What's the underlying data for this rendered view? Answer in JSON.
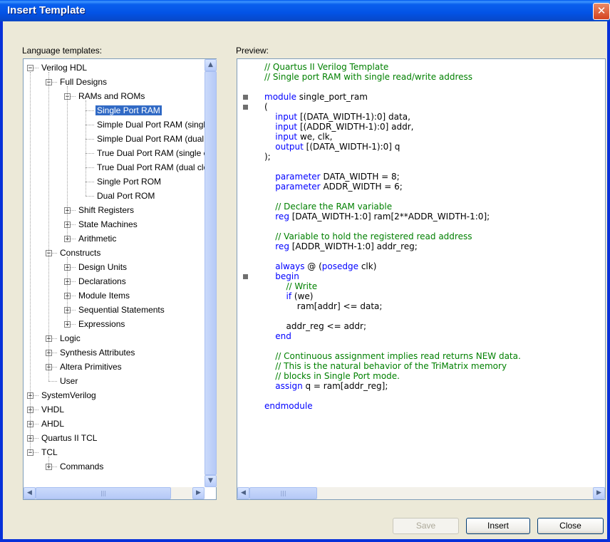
{
  "window": {
    "title": "Insert Template",
    "close_glyph": "✕"
  },
  "labels": {
    "templates": "Language templates:",
    "preview": "Preview:"
  },
  "tree": [
    {
      "label": "Verilog HDL",
      "depth": 0,
      "expander": "minus"
    },
    {
      "label": "Full Designs",
      "depth": 1,
      "expander": "minus"
    },
    {
      "label": "RAMs and ROMs",
      "depth": 2,
      "expander": "minus"
    },
    {
      "label": "Single Port RAM",
      "depth": 3,
      "expander": "none",
      "selected": true
    },
    {
      "label": "Simple Dual Port RAM (single clock)",
      "depth": 3,
      "expander": "none"
    },
    {
      "label": "Simple Dual Port RAM (dual clock)",
      "depth": 3,
      "expander": "none"
    },
    {
      "label": "True Dual Port RAM (single clock)",
      "depth": 3,
      "expander": "none"
    },
    {
      "label": "True Dual Port RAM (dual clock)",
      "depth": 3,
      "expander": "none"
    },
    {
      "label": "Single Port ROM",
      "depth": 3,
      "expander": "none"
    },
    {
      "label": "Dual Port ROM",
      "depth": 3,
      "expander": "none"
    },
    {
      "label": "Shift Registers",
      "depth": 2,
      "expander": "plus"
    },
    {
      "label": "State Machines",
      "depth": 2,
      "expander": "plus"
    },
    {
      "label": "Arithmetic",
      "depth": 2,
      "expander": "plus"
    },
    {
      "label": "Constructs",
      "depth": 1,
      "expander": "minus"
    },
    {
      "label": "Design Units",
      "depth": 2,
      "expander": "plus"
    },
    {
      "label": "Declarations",
      "depth": 2,
      "expander": "plus"
    },
    {
      "label": "Module Items",
      "depth": 2,
      "expander": "plus"
    },
    {
      "label": "Sequential Statements",
      "depth": 2,
      "expander": "plus"
    },
    {
      "label": "Expressions",
      "depth": 2,
      "expander": "plus"
    },
    {
      "label": "Logic",
      "depth": 1,
      "expander": "plus"
    },
    {
      "label": "Synthesis Attributes",
      "depth": 1,
      "expander": "plus"
    },
    {
      "label": "Altera Primitives",
      "depth": 1,
      "expander": "plus"
    },
    {
      "label": "User",
      "depth": 1,
      "expander": "none"
    },
    {
      "label": "SystemVerilog",
      "depth": 0,
      "expander": "plus"
    },
    {
      "label": "VHDL",
      "depth": 0,
      "expander": "plus"
    },
    {
      "label": "AHDL",
      "depth": 0,
      "expander": "plus"
    },
    {
      "label": "Quartus II TCL",
      "depth": 0,
      "expander": "plus"
    },
    {
      "label": "TCL",
      "depth": 0,
      "expander": "minus"
    },
    {
      "label": "Commands",
      "depth": 1,
      "expander": "plus"
    }
  ],
  "code_lines": [
    {
      "y": 0,
      "fold": false,
      "parts": [
        [
          "cm",
          "// Quartus II Verilog Template"
        ]
      ]
    },
    {
      "y": 1,
      "fold": false,
      "parts": [
        [
          "cm",
          "// Single port RAM with single read/write address"
        ]
      ]
    },
    {
      "y": 3,
      "fold": true,
      "parts": [
        [
          "kw",
          "module"
        ],
        [
          "",
          " single_port_ram"
        ]
      ]
    },
    {
      "y": 4,
      "fold": true,
      "parts": [
        [
          "",
          "("
        ]
      ]
    },
    {
      "y": 5,
      "fold": false,
      "parts": [
        [
          "",
          "\t"
        ],
        [
          "kw",
          "input"
        ],
        [
          "",
          " [(DATA_WIDTH-1):0] data,"
        ]
      ]
    },
    {
      "y": 6,
      "fold": false,
      "parts": [
        [
          "",
          "\t"
        ],
        [
          "kw",
          "input"
        ],
        [
          "",
          " [(ADDR_WIDTH-1):0] addr,"
        ]
      ]
    },
    {
      "y": 7,
      "fold": false,
      "parts": [
        [
          "",
          "\t"
        ],
        [
          "kw",
          "input"
        ],
        [
          "",
          " we, clk,"
        ]
      ]
    },
    {
      "y": 8,
      "fold": false,
      "parts": [
        [
          "",
          "\t"
        ],
        [
          "kw",
          "output"
        ],
        [
          "",
          " [(DATA_WIDTH-1):0] q"
        ]
      ]
    },
    {
      "y": 9,
      "fold": false,
      "parts": [
        [
          "",
          ");"
        ]
      ]
    },
    {
      "y": 11,
      "fold": false,
      "parts": [
        [
          "",
          "\t"
        ],
        [
          "kw",
          "parameter"
        ],
        [
          "",
          " DATA_WIDTH = 8;"
        ]
      ]
    },
    {
      "y": 12,
      "fold": false,
      "parts": [
        [
          "",
          "\t"
        ],
        [
          "kw",
          "parameter"
        ],
        [
          "",
          " ADDR_WIDTH = 6;"
        ]
      ]
    },
    {
      "y": 14,
      "fold": false,
      "parts": [
        [
          "",
          "\t"
        ],
        [
          "cm",
          "// Declare the RAM variable"
        ]
      ]
    },
    {
      "y": 15,
      "fold": false,
      "parts": [
        [
          "",
          "\t"
        ],
        [
          "kw",
          "reg"
        ],
        [
          "",
          " [DATA_WIDTH-1:0] ram[2**ADDR_WIDTH-1:0];"
        ]
      ]
    },
    {
      "y": 17,
      "fold": false,
      "parts": [
        [
          "",
          "\t"
        ],
        [
          "cm",
          "// Variable to hold the registered read address"
        ]
      ]
    },
    {
      "y": 18,
      "fold": false,
      "parts": [
        [
          "",
          "\t"
        ],
        [
          "kw",
          "reg"
        ],
        [
          "",
          " [ADDR_WIDTH-1:0] addr_reg;"
        ]
      ]
    },
    {
      "y": 20,
      "fold": false,
      "parts": [
        [
          "",
          "\t"
        ],
        [
          "kw",
          "always"
        ],
        [
          "",
          " @ ("
        ],
        [
          "kw",
          "posedge"
        ],
        [
          "",
          " clk)"
        ]
      ]
    },
    {
      "y": 21,
      "fold": true,
      "parts": [
        [
          "",
          "\t"
        ],
        [
          "kw",
          "begin"
        ]
      ]
    },
    {
      "y": 22,
      "fold": false,
      "parts": [
        [
          "",
          "\t\t"
        ],
        [
          "cm",
          "// Write"
        ]
      ]
    },
    {
      "y": 23,
      "fold": false,
      "parts": [
        [
          "",
          "\t\t"
        ],
        [
          "kw",
          "if"
        ],
        [
          "",
          " (we)"
        ]
      ]
    },
    {
      "y": 24,
      "fold": false,
      "parts": [
        [
          "",
          "\t\t\tram[addr] <= data;"
        ]
      ]
    },
    {
      "y": 26,
      "fold": false,
      "parts": [
        [
          "",
          "\t\taddr_reg <= addr;"
        ]
      ]
    },
    {
      "y": 27,
      "fold": false,
      "parts": [
        [
          "",
          "\t"
        ],
        [
          "kw",
          "end"
        ]
      ]
    },
    {
      "y": 29,
      "fold": false,
      "parts": [
        [
          "",
          "\t"
        ],
        [
          "cm",
          "// Continuous assignment implies read returns NEW data."
        ]
      ]
    },
    {
      "y": 30,
      "fold": false,
      "parts": [
        [
          "",
          "\t"
        ],
        [
          "cm",
          "// This is the natural behavior of the TriMatrix memory"
        ]
      ]
    },
    {
      "y": 31,
      "fold": false,
      "parts": [
        [
          "",
          "\t"
        ],
        [
          "cm",
          "// blocks in Single Port mode."
        ]
      ]
    },
    {
      "y": 32,
      "fold": false,
      "parts": [
        [
          "",
          "\t"
        ],
        [
          "kw",
          "assign"
        ],
        [
          "",
          " q = ram[addr_reg];"
        ]
      ]
    },
    {
      "y": 34,
      "fold": false,
      "parts": [
        [
          "kw",
          "endmodule"
        ]
      ]
    }
  ],
  "scroll_glyphs": {
    "up": "▲",
    "down": "▼",
    "left": "◀",
    "right": "▶",
    "grip_v": "≡",
    "grip_h": "|||"
  },
  "buttons": {
    "save": "Save",
    "insert": "Insert",
    "close": "Close"
  },
  "colors": {
    "selection": "#316ac5",
    "comment": "#008000",
    "keyword": "#0000ff"
  }
}
